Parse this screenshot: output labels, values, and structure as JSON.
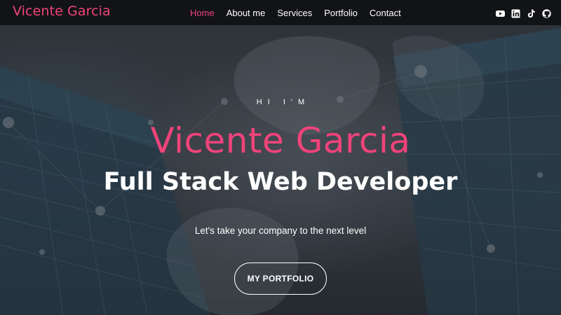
{
  "brand": {
    "name": "Vicente Garcia"
  },
  "nav": {
    "items": [
      {
        "label": "Home",
        "active": true
      },
      {
        "label": "About me",
        "active": false
      },
      {
        "label": "Services",
        "active": false
      },
      {
        "label": "Portfolio",
        "active": false
      },
      {
        "label": "Contact",
        "active": false
      }
    ]
  },
  "social": [
    {
      "icon": "youtube-icon"
    },
    {
      "icon": "linkedin-icon"
    },
    {
      "icon": "tiktok-icon"
    },
    {
      "icon": "github-icon"
    }
  ],
  "hero": {
    "greeting": "HI I'M",
    "name": "Vicente Garcia",
    "role": "Full Stack Web Developer",
    "tagline": "Let's take your company to the next level",
    "cta_label": "MY PORTFOLIO"
  },
  "colors": {
    "accent": "#f0437a",
    "nav_background": "#121316",
    "text": "#ffffff"
  }
}
